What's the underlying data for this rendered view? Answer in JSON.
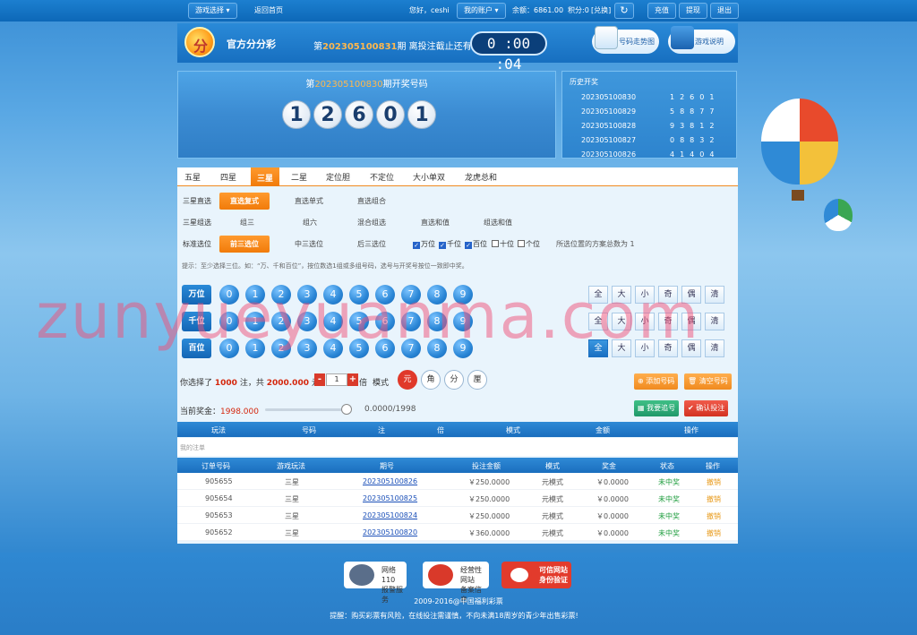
{
  "topbar": {
    "game_select": "游戏选择",
    "home": "返回首页",
    "greeting": "您好，ceshi",
    "my_account": "我的账户",
    "balance": "余额：6861.00",
    "points": "积分:0",
    "exchange": "[兑换]",
    "recharge": "充值",
    "withdraw": "提现",
    "logout": "退出"
  },
  "header": {
    "logo_char": "分",
    "title": "官方分分彩",
    "period_prefix": "第",
    "period": "202305100831",
    "period_suffix": "期 离投注截止还有",
    "countdown": "0 :00 :04",
    "trend_btn": "号码走势图",
    "rules_btn": "游戏说明"
  },
  "draw": {
    "prefix": "第",
    "period": "202305100830",
    "suffix": "期开奖号码",
    "balls": [
      "1",
      "2",
      "6",
      "0",
      "1"
    ]
  },
  "history": {
    "title": "历史开奖",
    "rows": [
      {
        "period": "202305100830",
        "digits": "12601"
      },
      {
        "period": "202305100829",
        "digits": "58877"
      },
      {
        "period": "202305100828",
        "digits": "93812"
      },
      {
        "period": "202305100827",
        "digits": "08832"
      },
      {
        "period": "202305100826",
        "digits": "41404"
      }
    ]
  },
  "tabs": [
    "五星",
    "四星",
    "三星",
    "二星",
    "定位胆",
    "不定位",
    "大小单双",
    "龙虎总和"
  ],
  "rows": {
    "r1_label": "三星直选",
    "r1_opts": [
      "直选复式",
      "直选单式",
      "直选组合"
    ],
    "r2_label": "三星组选",
    "r2_opts": [
      "组三",
      "组六",
      "混合组选",
      "直选和值",
      "组选和值"
    ],
    "r3_label": "标准选位",
    "r3_opts": [
      "前三选位",
      "中三选位",
      "后三选位"
    ],
    "positions": [
      "万位",
      "千位",
      "百位",
      "十位",
      "个位"
    ],
    "pos_note": "所选位置的方案总数为 1"
  },
  "tip": "提示：至少选择三位。如：“万、千和百位”，按位数选1组或多组号码，选号与开奖号按位一致即中奖。",
  "picker": {
    "rows": [
      "万位",
      "千位",
      "百位"
    ],
    "digits": [
      "0",
      "1",
      "2",
      "3",
      "4",
      "5",
      "6",
      "7",
      "8",
      "9"
    ],
    "filters": [
      "全",
      "大",
      "小",
      "奇",
      "偶",
      "清"
    ]
  },
  "bet": {
    "selected_prefix": "你选择了",
    "count": "1000",
    "mid1": "注，共",
    "amount": "2000.000",
    "mid2": "元",
    "multiplier": "1",
    "times_label": "倍",
    "mode_label": "模式",
    "modes": [
      "元",
      "角",
      "分",
      "厘"
    ],
    "add_btn": "添加号码",
    "clear_btn": "清空号码",
    "chase_btn": "我要追号",
    "confirm_btn": "确认投注"
  },
  "prize": {
    "label": "当前奖金：",
    "value": "1998.000",
    "rate": "0.0000/1998"
  },
  "cart": {
    "headers": [
      "玩法",
      "号码",
      "注",
      "倍",
      "模式",
      "金额",
      "操作"
    ],
    "empty": "我的注单"
  },
  "orders": {
    "headers": [
      "订单号码",
      "游戏玩法",
      "期号",
      "投注金额",
      "模式",
      "奖金",
      "状态",
      "操作"
    ],
    "rows": [
      [
        "905655",
        "三星",
        "202305100826",
        "￥250.0000",
        "元模式",
        "￥0.0000",
        "未中奖",
        "撤销"
      ],
      [
        "905654",
        "三星",
        "202305100825",
        "￥250.0000",
        "元模式",
        "￥0.0000",
        "未中奖",
        "撤销"
      ],
      [
        "905653",
        "三星",
        "202305100824",
        "￥250.0000",
        "元模式",
        "￥0.0000",
        "未中奖",
        "撤销"
      ],
      [
        "905652",
        "三星",
        "202305100820",
        "￥360.0000",
        "元模式",
        "￥0.0000",
        "未中奖",
        "撤销"
      ]
    ]
  },
  "footer": {
    "badges": [
      {
        "line1": "网络110",
        "line2": "报警服务"
      },
      {
        "line1": "经营性网站",
        "line2": "备案信息"
      },
      {
        "line1": "可信网站",
        "line2": "身份验证"
      }
    ],
    "copyright": "2009-2016@中国福利彩票",
    "notice": "提醒：购买彩票有风险，在线投注需谨慎，不向未满18周岁的青少年出售彩票!"
  },
  "watermark": "zunyueyuanma.com",
  "colors": {
    "accent": "#f17b0a",
    "primary": "#1a6ebe",
    "danger": "#d4260c",
    "win_status": "#1e9d3e"
  }
}
